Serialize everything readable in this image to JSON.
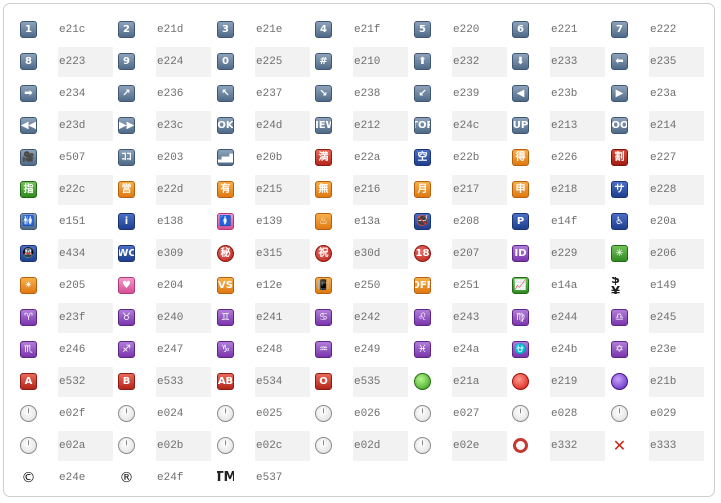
{
  "rows": [
    [
      {
        "glyph": "1",
        "style": "blue",
        "name": "keycap-1-icon",
        "code": "e21c"
      },
      {
        "glyph": "2",
        "style": "blue",
        "name": "keycap-2-icon",
        "code": "e21d"
      },
      {
        "glyph": "3",
        "style": "blue",
        "name": "keycap-3-icon",
        "code": "e21e"
      },
      {
        "glyph": "4",
        "style": "blue",
        "name": "keycap-4-icon",
        "code": "e21f"
      },
      {
        "glyph": "5",
        "style": "blue",
        "name": "keycap-5-icon",
        "code": "e220"
      },
      {
        "glyph": "6",
        "style": "blue",
        "name": "keycap-6-icon",
        "code": "e221"
      },
      {
        "glyph": "7",
        "style": "blue",
        "name": "keycap-7-icon",
        "code": "e222"
      }
    ],
    [
      {
        "glyph": "8",
        "style": "blue",
        "name": "keycap-8-icon",
        "code": "e223"
      },
      {
        "glyph": "9",
        "style": "blue",
        "name": "keycap-9-icon",
        "code": "e224"
      },
      {
        "glyph": "0",
        "style": "blue",
        "name": "keycap-0-icon",
        "code": "e225"
      },
      {
        "glyph": "#",
        "style": "blue",
        "name": "keycap-hash-icon",
        "code": "e210"
      },
      {
        "glyph": "⬆",
        "style": "blue",
        "name": "arrow-up-icon",
        "code": "e232"
      },
      {
        "glyph": "⬇",
        "style": "blue",
        "name": "arrow-down-icon",
        "code": "e233"
      },
      {
        "glyph": "⬅",
        "style": "blue",
        "name": "arrow-left-icon",
        "code": "e235"
      }
    ],
    [
      {
        "glyph": "➡",
        "style": "blue",
        "name": "arrow-right-icon",
        "code": "e234"
      },
      {
        "glyph": "↗",
        "style": "blue",
        "name": "arrow-upper-right-icon",
        "code": "e236"
      },
      {
        "glyph": "↖",
        "style": "blue",
        "name": "arrow-upper-left-icon",
        "code": "e237"
      },
      {
        "glyph": "↘",
        "style": "blue",
        "name": "arrow-lower-right-icon",
        "code": "e238"
      },
      {
        "glyph": "↙",
        "style": "blue",
        "name": "arrow-lower-left-icon",
        "code": "e239"
      },
      {
        "glyph": "◀",
        "style": "blue",
        "name": "arrow-backward-icon",
        "code": "e23b"
      },
      {
        "glyph": "▶",
        "style": "blue",
        "name": "arrow-forward-icon",
        "code": "e23a"
      }
    ],
    [
      {
        "glyph": "◀◀",
        "style": "blue",
        "name": "rewind-icon",
        "code": "e23d"
      },
      {
        "glyph": "▶▶",
        "style": "blue",
        "name": "fast-forward-icon",
        "code": "e23c"
      },
      {
        "glyph": "OK",
        "style": "blue",
        "name": "ok-icon",
        "code": "e24d"
      },
      {
        "glyph": "NEW",
        "style": "blue",
        "name": "new-icon",
        "code": "e212"
      },
      {
        "glyph": "TOP",
        "style": "blue",
        "name": "top-icon",
        "code": "e24c"
      },
      {
        "glyph": "UP",
        "style": "blue",
        "name": "up-icon",
        "code": "e213"
      },
      {
        "glyph": "COOL",
        "style": "blue",
        "name": "cool-icon",
        "code": "e214"
      }
    ],
    [
      {
        "glyph": "🎥",
        "style": "blue",
        "name": "cinema-icon",
        "code": "e507"
      },
      {
        "glyph": "ｺｺ",
        "style": "blue",
        "name": "koko-icon",
        "code": "e203"
      },
      {
        "glyph": "▂▄▆",
        "style": "blue",
        "name": "signal-strength-icon",
        "code": "e20b"
      },
      {
        "glyph": "満",
        "style": "red",
        "name": "full-icon",
        "code": "e22a"
      },
      {
        "glyph": "空",
        "style": "navy",
        "name": "vacancy-icon",
        "code": "e22b"
      },
      {
        "glyph": "得",
        "style": "orange",
        "name": "bargain-icon",
        "code": "e226"
      },
      {
        "glyph": "割",
        "style": "darkred",
        "name": "discount-icon",
        "code": "e227"
      }
    ],
    [
      {
        "glyph": "指",
        "style": "green",
        "name": "reserved-icon",
        "code": "e22c"
      },
      {
        "glyph": "営",
        "style": "orange",
        "name": "open-for-business-icon",
        "code": "e22d"
      },
      {
        "glyph": "有",
        "style": "orange",
        "name": "not-free-icon",
        "code": "e215"
      },
      {
        "glyph": "無",
        "style": "orange",
        "name": "free-icon",
        "code": "e216"
      },
      {
        "glyph": "月",
        "style": "orange",
        "name": "monthly-icon",
        "code": "e217"
      },
      {
        "glyph": "申",
        "style": "orange",
        "name": "application-icon",
        "code": "e218"
      },
      {
        "glyph": "サ",
        "style": "navy",
        "name": "service-icon",
        "code": "e228"
      }
    ],
    [
      {
        "glyph": "🚻",
        "style": "blue",
        "name": "restroom-icon",
        "code": "e151"
      },
      {
        "glyph": "i",
        "style": "navy",
        "name": "information-icon",
        "code": "e138"
      },
      {
        "glyph": "🚺",
        "style": "pink",
        "name": "womens-icon",
        "code": "e139"
      },
      {
        "glyph": "♨",
        "style": "orange",
        "name": "hot-springs-icon",
        "code": "e13a"
      },
      {
        "glyph": "🚭",
        "style": "navy",
        "name": "no-smoking-icon",
        "code": "e208"
      },
      {
        "glyph": "P",
        "style": "navy",
        "name": "parking-icon",
        "code": "e14f"
      },
      {
        "glyph": "♿",
        "style": "navy",
        "name": "wheelchair-icon",
        "code": "e20a"
      }
    ],
    [
      {
        "glyph": "🚇",
        "style": "navy",
        "name": "metro-icon",
        "code": "e434"
      },
      {
        "glyph": "WC",
        "style": "navy",
        "name": "wc-icon",
        "code": "e309"
      },
      {
        "glyph": "秘",
        "style": "circle-red",
        "name": "secret-icon",
        "code": "e315"
      },
      {
        "glyph": "祝",
        "style": "circle-red",
        "name": "congratulations-icon",
        "code": "e30d"
      },
      {
        "glyph": "18",
        "style": "circle-red",
        "name": "underage-icon",
        "code": "e207"
      },
      {
        "glyph": "ID",
        "style": "purple",
        "name": "id-icon",
        "code": "e229"
      },
      {
        "glyph": "✳",
        "style": "green",
        "name": "eight-spoked-asterisk-icon",
        "code": "e206"
      }
    ],
    [
      {
        "glyph": "✴",
        "style": "orange",
        "name": "eight-pointed-star-icon",
        "code": "e205"
      },
      {
        "glyph": "♥",
        "style": "pink",
        "name": "heart-decoration-icon",
        "code": "e204"
      },
      {
        "glyph": "VS",
        "style": "orange",
        "name": "vs-icon",
        "code": "e12e"
      },
      {
        "glyph": "📳",
        "style": "orange",
        "name": "vibration-mode-icon",
        "code": "e250"
      },
      {
        "glyph": "OFF",
        "style": "orange",
        "name": "mobile-phone-off-icon",
        "code": "e251"
      },
      {
        "glyph": "📈",
        "style": "green",
        "name": "chart-icon",
        "code": "e14a"
      },
      {
        "glyph": "$¥",
        "style": "plainbig",
        "name": "currency-exchange-icon",
        "code": "e149"
      }
    ],
    [
      {
        "glyph": "♈",
        "style": "purple",
        "name": "aries-icon",
        "code": "e23f"
      },
      {
        "glyph": "♉",
        "style": "purple",
        "name": "taurus-icon",
        "code": "e240"
      },
      {
        "glyph": "♊",
        "style": "purple",
        "name": "gemini-icon",
        "code": "e241"
      },
      {
        "glyph": "♋",
        "style": "purple",
        "name": "cancer-icon",
        "code": "e242"
      },
      {
        "glyph": "♌",
        "style": "purple",
        "name": "leo-icon",
        "code": "e243"
      },
      {
        "glyph": "♍",
        "style": "purple",
        "name": "virgo-icon",
        "code": "e244"
      },
      {
        "glyph": "♎",
        "style": "purple",
        "name": "libra-icon",
        "code": "e245"
      }
    ],
    [
      {
        "glyph": "♏",
        "style": "purple",
        "name": "scorpius-icon",
        "code": "e246"
      },
      {
        "glyph": "♐",
        "style": "purple",
        "name": "sagittarius-icon",
        "code": "e247"
      },
      {
        "glyph": "♑",
        "style": "purple",
        "name": "capricorn-icon",
        "code": "e248"
      },
      {
        "glyph": "♒",
        "style": "purple",
        "name": "aquarius-icon",
        "code": "e249"
      },
      {
        "glyph": "♓",
        "style": "purple",
        "name": "pisces-icon",
        "code": "e24a"
      },
      {
        "glyph": "⛎",
        "style": "purple",
        "name": "ophiuchus-icon",
        "code": "e24b"
      },
      {
        "glyph": "✡",
        "style": "purple",
        "name": "six-pointed-star-icon",
        "code": "e23e"
      }
    ],
    [
      {
        "glyph": "A",
        "style": "red",
        "name": "blood-type-a-icon",
        "code": "e532"
      },
      {
        "glyph": "B",
        "style": "red",
        "name": "blood-type-b-icon",
        "code": "e533"
      },
      {
        "glyph": "AB",
        "style": "red",
        "name": "blood-type-ab-icon",
        "code": "e534"
      },
      {
        "glyph": "O",
        "style": "red",
        "name": "blood-type-o-icon",
        "code": "e535"
      },
      {
        "glyph": "",
        "style": "circle-green",
        "name": "green-circle-icon",
        "code": "e21a"
      },
      {
        "glyph": "",
        "style": "circle-redball",
        "name": "red-circle-icon",
        "code": "e219"
      },
      {
        "glyph": "",
        "style": "circle-purple",
        "name": "purple-circle-icon",
        "code": "e21b"
      }
    ],
    [
      {
        "glyph": "╵",
        "style": "clock",
        "name": "clock-one-icon",
        "code": "e02f"
      },
      {
        "glyph": "╵",
        "style": "clock",
        "name": "clock-two-icon",
        "code": "e024"
      },
      {
        "glyph": "╵",
        "style": "clock",
        "name": "clock-three-icon",
        "code": "e025"
      },
      {
        "glyph": "╵",
        "style": "clock",
        "name": "clock-four-icon",
        "code": "e026"
      },
      {
        "glyph": "╵",
        "style": "clock",
        "name": "clock-five-icon",
        "code": "e027"
      },
      {
        "glyph": "╵",
        "style": "clock",
        "name": "clock-six-icon",
        "code": "e028"
      },
      {
        "glyph": "╵",
        "style": "clock",
        "name": "clock-seven-icon",
        "code": "e029"
      }
    ],
    [
      {
        "glyph": "╵",
        "style": "clock",
        "name": "clock-eight-icon",
        "code": "e02a"
      },
      {
        "glyph": "╵",
        "style": "clock",
        "name": "clock-nine-icon",
        "code": "e02b"
      },
      {
        "glyph": "╵",
        "style": "clock",
        "name": "clock-ten-icon",
        "code": "e02c"
      },
      {
        "glyph": "╵",
        "style": "clock",
        "name": "clock-eleven-icon",
        "code": "e02d"
      },
      {
        "glyph": "╵",
        "style": "clock",
        "name": "clock-twelve-icon",
        "code": "e02e"
      },
      {
        "glyph": "",
        "style": "ring",
        "name": "hollow-red-circle-icon",
        "code": "e332"
      },
      {
        "glyph": "✕",
        "style": "xmark",
        "name": "cross-mark-icon",
        "code": "e333"
      }
    ],
    [
      {
        "glyph": "©",
        "style": "copy",
        "name": "copyright-icon",
        "code": "e24e"
      },
      {
        "glyph": "®",
        "style": "copy",
        "name": "registered-icon",
        "code": "e24f"
      },
      {
        "glyph": "TM",
        "style": "plainbig",
        "name": "trademark-icon",
        "code": "e537"
      }
    ]
  ]
}
